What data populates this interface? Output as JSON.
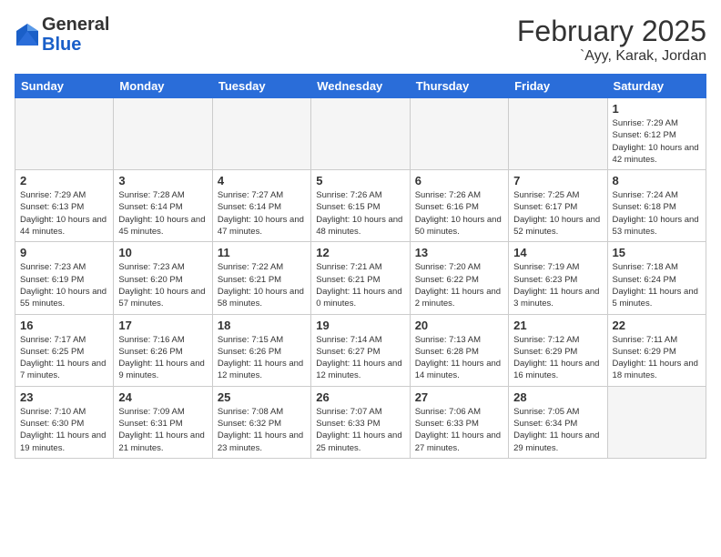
{
  "logo": {
    "general": "General",
    "blue": "Blue"
  },
  "header": {
    "month": "February 2025",
    "location": "`Ayy, Karak, Jordan"
  },
  "weekdays": [
    "Sunday",
    "Monday",
    "Tuesday",
    "Wednesday",
    "Thursday",
    "Friday",
    "Saturday"
  ],
  "weeks": [
    [
      {
        "day": "",
        "info": ""
      },
      {
        "day": "",
        "info": ""
      },
      {
        "day": "",
        "info": ""
      },
      {
        "day": "",
        "info": ""
      },
      {
        "day": "",
        "info": ""
      },
      {
        "day": "",
        "info": ""
      },
      {
        "day": "1",
        "info": "Sunrise: 7:29 AM\nSunset: 6:12 PM\nDaylight: 10 hours\nand 42 minutes."
      }
    ],
    [
      {
        "day": "2",
        "info": "Sunrise: 7:29 AM\nSunset: 6:13 PM\nDaylight: 10 hours\nand 44 minutes."
      },
      {
        "day": "3",
        "info": "Sunrise: 7:28 AM\nSunset: 6:14 PM\nDaylight: 10 hours\nand 45 minutes."
      },
      {
        "day": "4",
        "info": "Sunrise: 7:27 AM\nSunset: 6:14 PM\nDaylight: 10 hours\nand 47 minutes."
      },
      {
        "day": "5",
        "info": "Sunrise: 7:26 AM\nSunset: 6:15 PM\nDaylight: 10 hours\nand 48 minutes."
      },
      {
        "day": "6",
        "info": "Sunrise: 7:26 AM\nSunset: 6:16 PM\nDaylight: 10 hours\nand 50 minutes."
      },
      {
        "day": "7",
        "info": "Sunrise: 7:25 AM\nSunset: 6:17 PM\nDaylight: 10 hours\nand 52 minutes."
      },
      {
        "day": "8",
        "info": "Sunrise: 7:24 AM\nSunset: 6:18 PM\nDaylight: 10 hours\nand 53 minutes."
      }
    ],
    [
      {
        "day": "9",
        "info": "Sunrise: 7:23 AM\nSunset: 6:19 PM\nDaylight: 10 hours\nand 55 minutes."
      },
      {
        "day": "10",
        "info": "Sunrise: 7:23 AM\nSunset: 6:20 PM\nDaylight: 10 hours\nand 57 minutes."
      },
      {
        "day": "11",
        "info": "Sunrise: 7:22 AM\nSunset: 6:21 PM\nDaylight: 10 hours\nand 58 minutes."
      },
      {
        "day": "12",
        "info": "Sunrise: 7:21 AM\nSunset: 6:21 PM\nDaylight: 11 hours\nand 0 minutes."
      },
      {
        "day": "13",
        "info": "Sunrise: 7:20 AM\nSunset: 6:22 PM\nDaylight: 11 hours\nand 2 minutes."
      },
      {
        "day": "14",
        "info": "Sunrise: 7:19 AM\nSunset: 6:23 PM\nDaylight: 11 hours\nand 3 minutes."
      },
      {
        "day": "15",
        "info": "Sunrise: 7:18 AM\nSunset: 6:24 PM\nDaylight: 11 hours\nand 5 minutes."
      }
    ],
    [
      {
        "day": "16",
        "info": "Sunrise: 7:17 AM\nSunset: 6:25 PM\nDaylight: 11 hours\nand 7 minutes."
      },
      {
        "day": "17",
        "info": "Sunrise: 7:16 AM\nSunset: 6:26 PM\nDaylight: 11 hours\nand 9 minutes."
      },
      {
        "day": "18",
        "info": "Sunrise: 7:15 AM\nSunset: 6:26 PM\nDaylight: 11 hours\nand 12 minutes."
      },
      {
        "day": "19",
        "info": "Sunrise: 7:14 AM\nSunset: 6:27 PM\nDaylight: 11 hours\nand 12 minutes."
      },
      {
        "day": "20",
        "info": "Sunrise: 7:13 AM\nSunset: 6:28 PM\nDaylight: 11 hours\nand 14 minutes."
      },
      {
        "day": "21",
        "info": "Sunrise: 7:12 AM\nSunset: 6:29 PM\nDaylight: 11 hours\nand 16 minutes."
      },
      {
        "day": "22",
        "info": "Sunrise: 7:11 AM\nSunset: 6:29 PM\nDaylight: 11 hours\nand 18 minutes."
      }
    ],
    [
      {
        "day": "23",
        "info": "Sunrise: 7:10 AM\nSunset: 6:30 PM\nDaylight: 11 hours\nand 19 minutes."
      },
      {
        "day": "24",
        "info": "Sunrise: 7:09 AM\nSunset: 6:31 PM\nDaylight: 11 hours\nand 21 minutes."
      },
      {
        "day": "25",
        "info": "Sunrise: 7:08 AM\nSunset: 6:32 PM\nDaylight: 11 hours\nand 23 minutes."
      },
      {
        "day": "26",
        "info": "Sunrise: 7:07 AM\nSunset: 6:33 PM\nDaylight: 11 hours\nand 25 minutes."
      },
      {
        "day": "27",
        "info": "Sunrise: 7:06 AM\nSunset: 6:33 PM\nDaylight: 11 hours\nand 27 minutes."
      },
      {
        "day": "28",
        "info": "Sunrise: 7:05 AM\nSunset: 6:34 PM\nDaylight: 11 hours\nand 29 minutes."
      },
      {
        "day": "",
        "info": ""
      }
    ]
  ]
}
